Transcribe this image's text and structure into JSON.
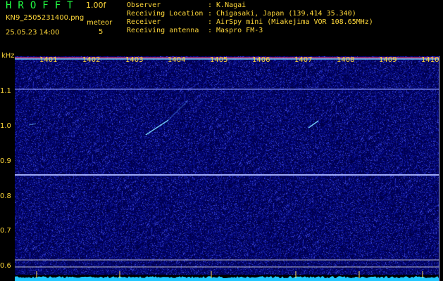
{
  "header": {
    "app_title": "HROFFT",
    "app_version": "1.00f",
    "file_name": "KN9_2505231400.png",
    "meteor_label": "meteor",
    "datetime": "25.05.23 14:00",
    "meteor_count": "5"
  },
  "info": [
    {
      "key": "Observer",
      "value": ": K.Nagai"
    },
    {
      "key": "Receiving Location",
      "value": ": Chigasaki, Japan (139.414 35.340)"
    },
    {
      "key": "Receiver",
      "value": ": AirSpy mini (Miakejima VOR 108.65MHz)"
    },
    {
      "key": "Receiving antenna",
      "value": ": Maspro FM-3"
    }
  ],
  "axis": {
    "y_unit": "kHz",
    "y_ticks": [
      "1.1",
      "1.0",
      "0.9",
      "0.8",
      "0.7",
      "0.6"
    ],
    "x_ticks": [
      "1401",
      "1402",
      "1403",
      "1404",
      "1405",
      "1406",
      "1407",
      "1408",
      "1409",
      "1410"
    ]
  },
  "colors": {
    "label": "#ffd83a",
    "title": "#22ff44",
    "background": "#000060",
    "carrier_line": "#a8b4ff",
    "bottom_band": "#20c8ff"
  }
}
